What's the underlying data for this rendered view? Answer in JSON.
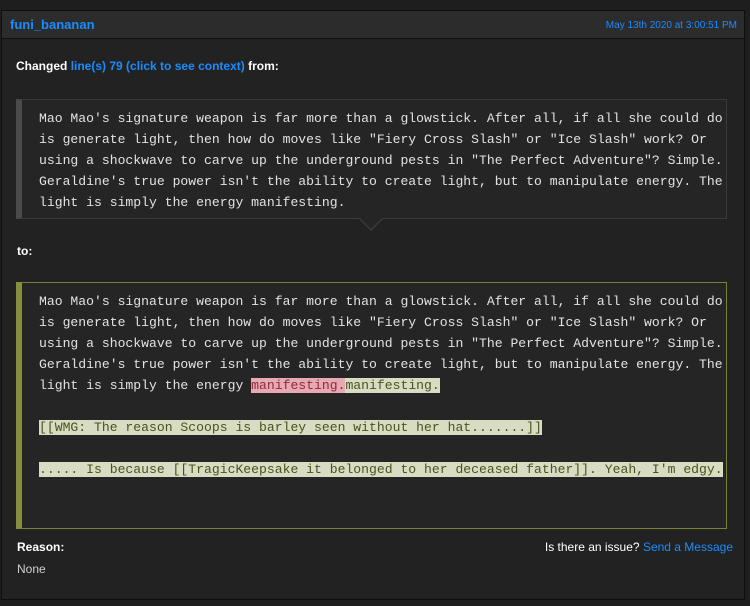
{
  "header": {
    "username": "funi_bananan",
    "timestamp": "May 13th 2020 at 3:00:51 PM"
  },
  "change": {
    "prefix": "Changed",
    "link_text": "line(s) 79 (click to see context)",
    "suffix": "from:",
    "to_label": "to:"
  },
  "from_text": "Mao Mao's signature weapon is far more than a glowstick. After all, if all she could do is generate light, then how do moves like \"Fiery Cross Slash\" or \"Ice Slash\" work? Or using a shockwave to carve up the underground pests in \"The Perfect Adventure\"? Simple. Geraldine's true power isn't the ability to create light, but to manipulate energy. The light is simply the energy manifesting.",
  "to": {
    "common": "Mao Mao's signature weapon is far more than a glowstick. After all, if all she could do is generate light, then how do moves like \"Fiery Cross Slash\" or \"Ice Slash\" work? Or using a shockwave to carve up the underground pests in \"The Perfect Adventure\"? Simple. Geraldine's true power isn't the ability to create light, but to manipulate energy. The light is simply the energy ",
    "deleted": "manifesting.",
    "inserted_tail": "manifesting.",
    "inserted_line1": "[[WMG: The reason Scoops is barley seen without her hat.......]]",
    "inserted_line2": "..... Is because [[TragicKeepsake it belonged to her deceased father]]. Yeah, I'm edgy."
  },
  "footer": {
    "reason_label": "Reason:",
    "reason_value": "None",
    "issue_text": "Is there an issue?",
    "send_message": "Send a Message"
  },
  "colors": {
    "accent": "#1a8cff",
    "deleted_bg": "#e8a8b4",
    "inserted_bg": "#d8dcc2",
    "to_border": "#878e3c"
  }
}
